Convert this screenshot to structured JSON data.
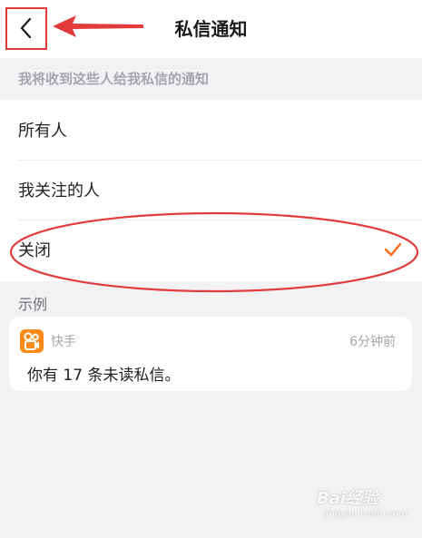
{
  "header": {
    "title": "私信通知",
    "back_icon": "chevron-left-icon"
  },
  "section": {
    "hint": "我将收到这些人给我私信的通知"
  },
  "options": [
    {
      "label": "所有人",
      "selected": false
    },
    {
      "label": "我关注的人",
      "selected": false
    },
    {
      "label": "关闭",
      "selected": true
    }
  ],
  "example": {
    "label": "示例",
    "app_name": "快手",
    "time": "6分钟前",
    "message": "你有 17 条未读私信。",
    "logo_icon": "kuaishou-logo-icon"
  },
  "watermark": {
    "text": "Bai经验",
    "sub": "jingyan.baidu.com"
  },
  "colors": {
    "accent": "#ff6a1a",
    "annotation": "#e23b3b",
    "logo": "#ff8a1a",
    "background": "#f2f2f4"
  }
}
